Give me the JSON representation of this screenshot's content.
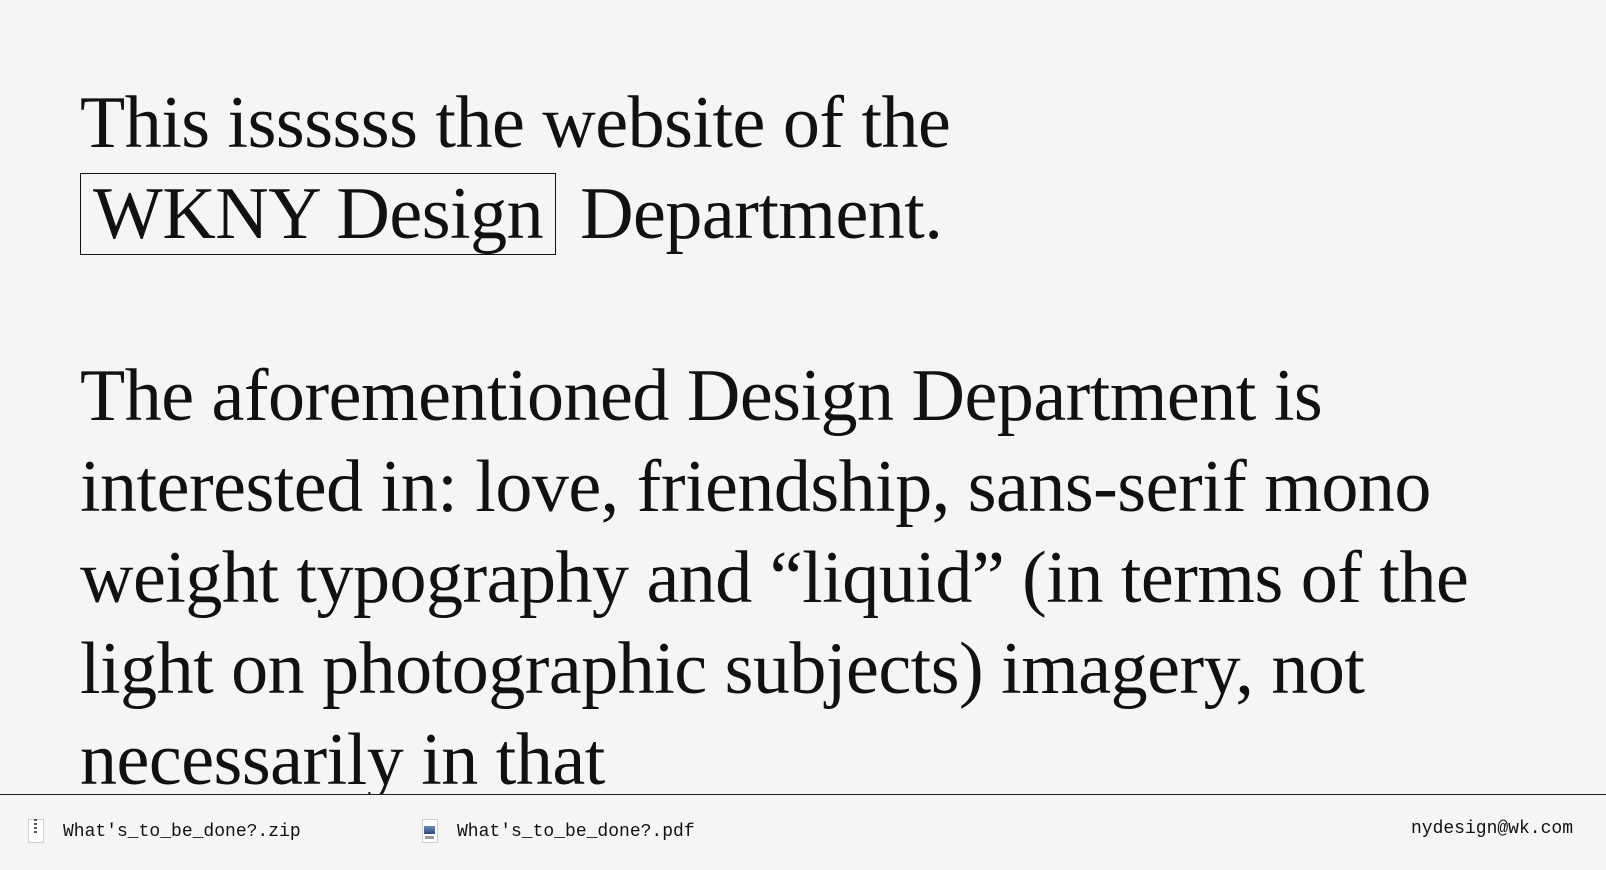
{
  "content": {
    "intro_prefix": "This issssss the website of the",
    "intro_boxed": "WKNY Design",
    "intro_suffix": "Department.",
    "body": "The aforementioned Design Department is interested in: love, friendship, sans-serif mono weight typography and “liquid” (in terms of the light on photographic subjects) imagery, not necessarily in that"
  },
  "footer": {
    "files": [
      {
        "label": "What's_to_be_done?.zip",
        "icon": "zip-file-icon"
      },
      {
        "label": "What's_to_be_done?.pdf",
        "icon": "pdf-file-icon"
      }
    ],
    "email": "nydesign@wk.com"
  },
  "colors": {
    "background": "#f5f5f5",
    "text": "#111111",
    "border": "#111111"
  }
}
